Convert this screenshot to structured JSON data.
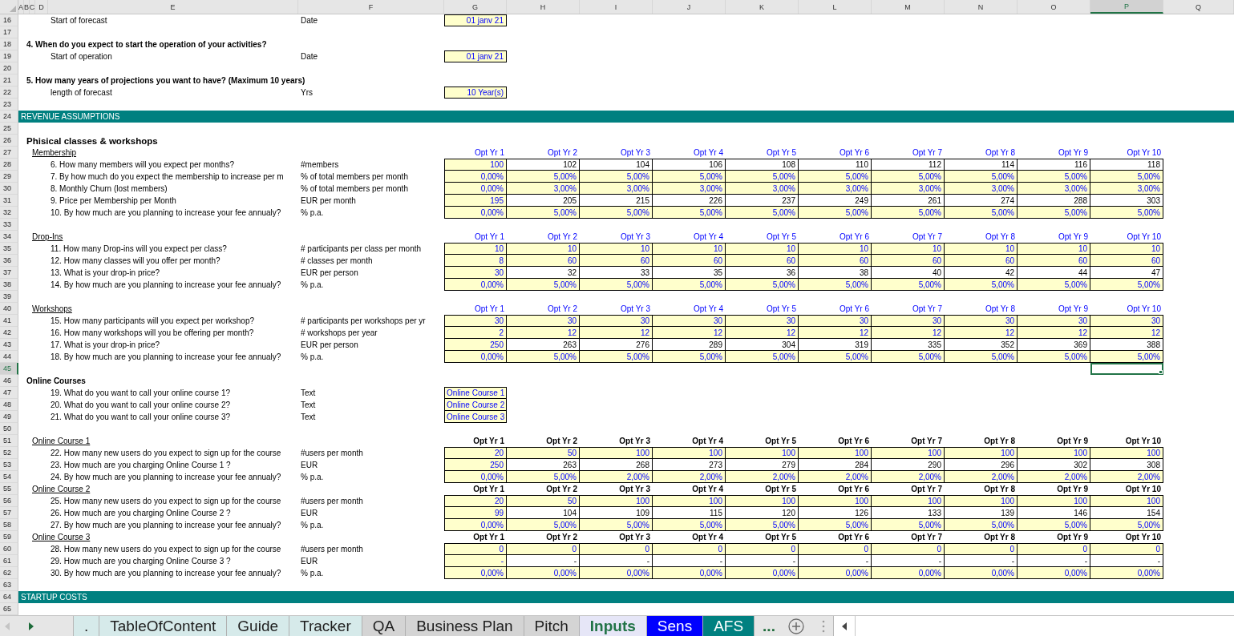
{
  "column_headers": [
    {
      "label": "A",
      "selected": false
    },
    {
      "label": "B",
      "selected": false
    },
    {
      "label": "C",
      "selected": false
    },
    {
      "label": "D",
      "selected": false
    },
    {
      "label": "E",
      "selected": false
    },
    {
      "label": "F",
      "selected": false
    },
    {
      "label": "G",
      "selected": false
    },
    {
      "label": "H",
      "selected": false
    },
    {
      "label": "I",
      "selected": false
    },
    {
      "label": "J",
      "selected": false
    },
    {
      "label": "K",
      "selected": false
    },
    {
      "label": "L",
      "selected": false
    },
    {
      "label": "M",
      "selected": false
    },
    {
      "label": "N",
      "selected": false
    },
    {
      "label": "O",
      "selected": false
    },
    {
      "label": "P",
      "selected": true
    },
    {
      "label": "Q",
      "selected": false
    }
  ],
  "rows": [
    {
      "number": "16",
      "selected": false,
      "kind": "field",
      "label": "Start of forecast",
      "unit": "Date",
      "value": "01 janv 21"
    },
    {
      "number": "17",
      "selected": false,
      "kind": "blank"
    },
    {
      "number": "18",
      "selected": false,
      "kind": "subtitle",
      "text": "4. When do you expect to start the operation of your activities?"
    },
    {
      "number": "19",
      "selected": false,
      "kind": "field",
      "label": "Start of operation",
      "unit": "Date",
      "value": "01 janv 21"
    },
    {
      "number": "20",
      "selected": false,
      "kind": "blank"
    },
    {
      "number": "21",
      "selected": false,
      "kind": "subtitle",
      "text": "5. How many years of projections you want to have? (Maximum 10 years)"
    },
    {
      "number": "22",
      "selected": false,
      "kind": "field",
      "label": "length of forecast",
      "unit": "Yrs",
      "value": "10 Year(s)"
    },
    {
      "number": "23",
      "selected": false,
      "kind": "blank"
    },
    {
      "number": "24",
      "selected": false,
      "kind": "band",
      "text": "REVENUE ASSUMPTIONS"
    },
    {
      "number": "25",
      "selected": false,
      "kind": "blank"
    },
    {
      "number": "26",
      "selected": false,
      "kind": "title",
      "text": "Phisical classes & workshops"
    },
    {
      "number": "27",
      "selected": false,
      "kind": "year_header",
      "section": "Membership",
      "bold": false,
      "labels": [
        "Opt Yr 1",
        "Opt Yr 2",
        "Opt Yr 3",
        "Opt Yr 4",
        "Opt Yr 5",
        "Opt Yr 6",
        "Opt Yr 7",
        "Opt Yr 8",
        "Opt Yr 9",
        "Opt Yr 10"
      ]
    },
    {
      "number": "28",
      "selected": false,
      "kind": "values",
      "label": "6. How many members will you expect per months?",
      "unit": "#members",
      "projection_input": false,
      "values": [
        "100",
        "102",
        "104",
        "106",
        "108",
        "110",
        "112",
        "114",
        "116",
        "118"
      ]
    },
    {
      "number": "29",
      "selected": false,
      "kind": "values",
      "label": "7. By how much do you expect the membership to increase per m",
      "unit": "% of total members per month",
      "projection_input": true,
      "values": [
        "0,00%",
        "5,00%",
        "5,00%",
        "5,00%",
        "5,00%",
        "5,00%",
        "5,00%",
        "5,00%",
        "5,00%",
        "5,00%"
      ]
    },
    {
      "number": "30",
      "selected": false,
      "kind": "values",
      "label": "8. Monthly Churn (lost members)",
      "unit": "% of total members per month",
      "projection_input": true,
      "values": [
        "0,00%",
        "3,00%",
        "3,00%",
        "3,00%",
        "3,00%",
        "3,00%",
        "3,00%",
        "3,00%",
        "3,00%",
        "3,00%"
      ]
    },
    {
      "number": "31",
      "selected": false,
      "kind": "values",
      "label": "9. Price per Membership per Month",
      "unit": "EUR per month",
      "projection_input": false,
      "values": [
        "195",
        "205",
        "215",
        "226",
        "237",
        "249",
        "261",
        "274",
        "288",
        "303"
      ]
    },
    {
      "number": "32",
      "selected": false,
      "kind": "values",
      "label": "10. By how much are you planning to increase your fee annualy?",
      "unit": "% p.a.",
      "projection_input": true,
      "values": [
        "0,00%",
        "5,00%",
        "5,00%",
        "5,00%",
        "5,00%",
        "5,00%",
        "5,00%",
        "5,00%",
        "5,00%",
        "5,00%"
      ]
    },
    {
      "number": "33",
      "selected": false,
      "kind": "blank"
    },
    {
      "number": "34",
      "selected": false,
      "kind": "year_header",
      "section": "Drop-Ins",
      "bold": false,
      "labels": [
        "Opt Yr 1",
        "Opt Yr 2",
        "Opt Yr 3",
        "Opt Yr 4",
        "Opt Yr 5",
        "Opt Yr 6",
        "Opt Yr 7",
        "Opt Yr 8",
        "Opt Yr 9",
        "Opt Yr 10"
      ]
    },
    {
      "number": "35",
      "selected": false,
      "kind": "values",
      "label": "11. How many Drop-ins will you expect per class?",
      "unit": "# participants per class per month",
      "projection_input": true,
      "values": [
        "10",
        "10",
        "10",
        "10",
        "10",
        "10",
        "10",
        "10",
        "10",
        "10"
      ]
    },
    {
      "number": "36",
      "selected": false,
      "kind": "values",
      "label": "12. How many classes will you offer per month?",
      "unit": "# classes per month",
      "projection_input": true,
      "values": [
        "8",
        "60",
        "60",
        "60",
        "60",
        "60",
        "60",
        "60",
        "60",
        "60"
      ]
    },
    {
      "number": "37",
      "selected": false,
      "kind": "values",
      "label": "13. What is your drop-in price?",
      "unit": "EUR per person",
      "projection_input": false,
      "values": [
        "30",
        "32",
        "33",
        "35",
        "36",
        "38",
        "40",
        "42",
        "44",
        "47"
      ]
    },
    {
      "number": "38",
      "selected": false,
      "kind": "values",
      "label": "14. By how much are you planning to increase your fee annualy?",
      "unit": "% p.a.",
      "projection_input": true,
      "values": [
        "0,00%",
        "5,00%",
        "5,00%",
        "5,00%",
        "5,00%",
        "5,00%",
        "5,00%",
        "5,00%",
        "5,00%",
        "5,00%"
      ]
    },
    {
      "number": "39",
      "selected": false,
      "kind": "blank"
    },
    {
      "number": "40",
      "selected": false,
      "kind": "year_header",
      "section": "Workshops",
      "bold": false,
      "labels": [
        "Opt Yr 1",
        "Opt Yr 2",
        "Opt Yr 3",
        "Opt Yr 4",
        "Opt Yr 5",
        "Opt Yr 6",
        "Opt Yr 7",
        "Opt Yr 8",
        "Opt Yr 9",
        "Opt Yr 10"
      ]
    },
    {
      "number": "41",
      "selected": false,
      "kind": "values",
      "label": "15. How many participants will you expect per workshop?",
      "unit": "# participants per workshops per yr",
      "projection_input": true,
      "values": [
        "30",
        "30",
        "30",
        "30",
        "30",
        "30",
        "30",
        "30",
        "30",
        "30"
      ]
    },
    {
      "number": "42",
      "selected": false,
      "kind": "values",
      "label": "16. How many workshops will you be offering per month?",
      "unit": "# workshops per year",
      "projection_input": true,
      "values": [
        "2",
        "12",
        "12",
        "12",
        "12",
        "12",
        "12",
        "12",
        "12",
        "12"
      ]
    },
    {
      "number": "43",
      "selected": false,
      "kind": "values",
      "label": "17. What is your drop-in price?",
      "unit": "EUR per person",
      "projection_input": false,
      "values": [
        "250",
        "263",
        "276",
        "289",
        "304",
        "319",
        "335",
        "352",
        "369",
        "388"
      ]
    },
    {
      "number": "44",
      "selected": false,
      "kind": "values",
      "label": "18. By how much are you planning to increase your fee annualy?",
      "unit": "% p.a.",
      "projection_input": true,
      "values": [
        "0,00%",
        "5,00%",
        "5,00%",
        "5,00%",
        "5,00%",
        "5,00%",
        "5,00%",
        "5,00%",
        "5,00%",
        "5,00%"
      ]
    },
    {
      "number": "45",
      "selected": true,
      "kind": "blank"
    },
    {
      "number": "46",
      "selected": false,
      "kind": "subtitle",
      "text": "Online Courses"
    },
    {
      "number": "47",
      "selected": false,
      "kind": "text_field",
      "label": "19. What do you want to call your online course 1?",
      "unit": "Text",
      "value": "Online Course 1"
    },
    {
      "number": "48",
      "selected": false,
      "kind": "text_field",
      "label": "20. What do you want to call your online course 2?",
      "unit": "Text",
      "value": "Online Course 2"
    },
    {
      "number": "49",
      "selected": false,
      "kind": "text_field",
      "label": "21. What do you want to call your online course 3?",
      "unit": "Text",
      "value": "Online Course 3"
    },
    {
      "number": "50",
      "selected": false,
      "kind": "blank"
    },
    {
      "number": "51",
      "selected": false,
      "kind": "year_header",
      "section": "Online Course 1",
      "bold": true,
      "labels": [
        "Opt Yr 1",
        "Opt Yr 2",
        "Opt Yr 3",
        "Opt Yr 4",
        "Opt Yr 5",
        "Opt Yr 6",
        "Opt Yr 7",
        "Opt Yr 8",
        "Opt Yr 9",
        "Opt Yr 10"
      ]
    },
    {
      "number": "52",
      "selected": false,
      "kind": "values",
      "label": "22. How many new users do you expect to sign up for the course",
      "unit": "#users per month",
      "projection_input": true,
      "values": [
        "20",
        "50",
        "100",
        "100",
        "100",
        "100",
        "100",
        "100",
        "100",
        "100"
      ]
    },
    {
      "number": "53",
      "selected": false,
      "kind": "values",
      "label": "23. How much are you charging Online Course 1 ?",
      "unit": "EUR",
      "projection_input": false,
      "values": [
        "250",
        "263",
        "268",
        "273",
        "279",
        "284",
        "290",
        "296",
        "302",
        "308"
      ]
    },
    {
      "number": "54",
      "selected": false,
      "kind": "values",
      "label": "24. By how much are you planning to increase your fee annualy?",
      "unit": "% p.a.",
      "projection_input": true,
      "values": [
        "0,00%",
        "5,00%",
        "2,00%",
        "2,00%",
        "2,00%",
        "2,00%",
        "2,00%",
        "2,00%",
        "2,00%",
        "2,00%"
      ]
    },
    {
      "number": "55",
      "selected": false,
      "kind": "year_header",
      "section": "Online Course 2",
      "bold": true,
      "labels": [
        "Opt Yr 1",
        "Opt Yr 2",
        "Opt Yr 3",
        "Opt Yr 4",
        "Opt Yr 5",
        "Opt Yr 6",
        "Opt Yr 7",
        "Opt Yr 8",
        "Opt Yr 9",
        "Opt Yr 10"
      ]
    },
    {
      "number": "56",
      "selected": false,
      "kind": "values",
      "label": "25. How many new users do you expect to sign up for the course",
      "unit": "#users per month",
      "projection_input": true,
      "values": [
        "20",
        "50",
        "100",
        "100",
        "100",
        "100",
        "100",
        "100",
        "100",
        "100"
      ]
    },
    {
      "number": "57",
      "selected": false,
      "kind": "values",
      "label": "26. How much are you charging Online Course 2 ?",
      "unit": "EUR",
      "projection_input": false,
      "values": [
        "99",
        "104",
        "109",
        "115",
        "120",
        "126",
        "133",
        "139",
        "146",
        "154"
      ]
    },
    {
      "number": "58",
      "selected": false,
      "kind": "values",
      "label": "27. By how much are you planning to increase your fee annualy?",
      "unit": "% p.a.",
      "projection_input": true,
      "values": [
        "0,00%",
        "5,00%",
        "5,00%",
        "5,00%",
        "5,00%",
        "5,00%",
        "5,00%",
        "5,00%",
        "5,00%",
        "5,00%"
      ]
    },
    {
      "number": "59",
      "selected": false,
      "kind": "year_header",
      "section": "Online Course 3",
      "bold": true,
      "labels": [
        "Opt Yr 1",
        "Opt Yr 2",
        "Opt Yr 3",
        "Opt Yr 4",
        "Opt Yr 5",
        "Opt Yr 6",
        "Opt Yr 7",
        "Opt Yr 8",
        "Opt Yr 9",
        "Opt Yr 10"
      ]
    },
    {
      "number": "60",
      "selected": false,
      "kind": "values",
      "label": "28. How many new users do you expect to sign up for the course",
      "unit": "#users per month",
      "projection_input": true,
      "values": [
        "0",
        "0",
        "0",
        "0",
        "0",
        "0",
        "0",
        "0",
        "0",
        "0"
      ]
    },
    {
      "number": "61",
      "selected": false,
      "kind": "values",
      "label": "29. How much are you charging Online Course 3 ?",
      "unit": "EUR",
      "projection_input": false,
      "values": [
        "-",
        "-",
        "-",
        "-",
        "-",
        "-",
        "-",
        "-",
        "-",
        "-"
      ]
    },
    {
      "number": "62",
      "selected": false,
      "kind": "values",
      "label": "30. By how much are you planning to increase your fee annualy?",
      "unit": "% p.a.",
      "projection_input": true,
      "values": [
        "0,00%",
        "0,00%",
        "0,00%",
        "0,00%",
        "0,00%",
        "0,00%",
        "0,00%",
        "0,00%",
        "0,00%",
        "0,00%"
      ]
    },
    {
      "number": "63",
      "selected": false,
      "kind": "blank"
    },
    {
      "number": "64",
      "selected": false,
      "kind": "band",
      "text": "STARTUP COSTS"
    },
    {
      "number": "65",
      "selected": false,
      "kind": "blank"
    }
  ],
  "sheet_nav": {
    "previous_disabled": true,
    "next_disabled": false
  },
  "sheet_tabs": [
    {
      "label": ".",
      "color": "#d6eaea",
      "selected": false
    },
    {
      "label": "TableOfContent",
      "color": "#d6eaea",
      "selected": false
    },
    {
      "label": "Guide",
      "color": "#d6eaea",
      "selected": false
    },
    {
      "label": "Tracker",
      "color": "#d6eaea",
      "selected": false
    },
    {
      "label": "QA",
      "color": "#d4d4d4",
      "selected": false
    },
    {
      "label": "Business Plan",
      "color": "#d4d4d4",
      "selected": false
    },
    {
      "label": "Pitch",
      "color": "#d4d4d4",
      "selected": false
    },
    {
      "label": "Inputs",
      "color": "#e6e6f7",
      "selected": true
    },
    {
      "label": "Sens",
      "color": "#0000ff",
      "selected": false
    },
    {
      "label": "AFS",
      "color": "#008080",
      "selected": false
    }
  ],
  "more_tabs": "..."
}
